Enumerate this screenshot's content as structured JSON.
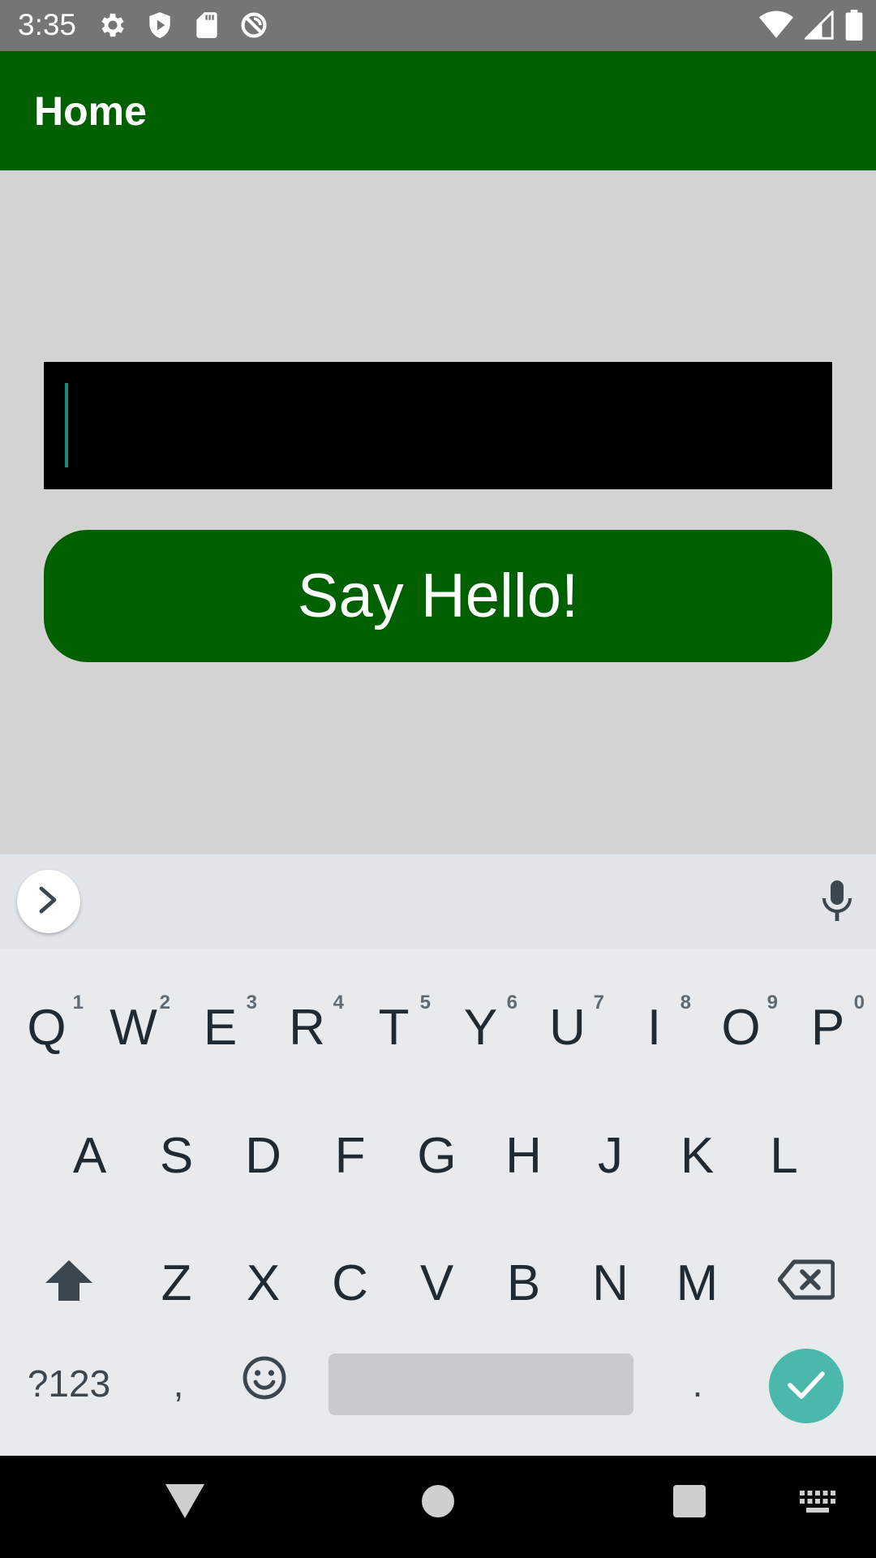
{
  "status_bar": {
    "time": "3:35",
    "left_icons": [
      "gear-icon",
      "shield-icon",
      "sd-card-icon",
      "no-sync-icon"
    ],
    "right_icons": [
      "wifi-icon",
      "cell-signal-icon",
      "battery-icon"
    ]
  },
  "app_bar": {
    "title": "Home"
  },
  "main": {
    "text_entry_value": "",
    "button_label": "Say Hello!"
  },
  "keyboard": {
    "row1": [
      {
        "letter": "Q",
        "hint": "1"
      },
      {
        "letter": "W",
        "hint": "2"
      },
      {
        "letter": "E",
        "hint": "3"
      },
      {
        "letter": "R",
        "hint": "4"
      },
      {
        "letter": "T",
        "hint": "5"
      },
      {
        "letter": "Y",
        "hint": "6"
      },
      {
        "letter": "U",
        "hint": "7"
      },
      {
        "letter": "I",
        "hint": "8"
      },
      {
        "letter": "O",
        "hint": "9"
      },
      {
        "letter": "P",
        "hint": "0"
      }
    ],
    "row2": [
      "A",
      "S",
      "D",
      "F",
      "G",
      "H",
      "J",
      "K",
      "L"
    ],
    "row3": [
      "Z",
      "X",
      "C",
      "V",
      "B",
      "N",
      "M"
    ],
    "symbols_label": "?123",
    "comma": ",",
    "period": ".",
    "accent_color": "#4ab8ab"
  },
  "colors": {
    "app_bar": "#006000",
    "button": "#006000",
    "background": "#d3d3d3"
  }
}
